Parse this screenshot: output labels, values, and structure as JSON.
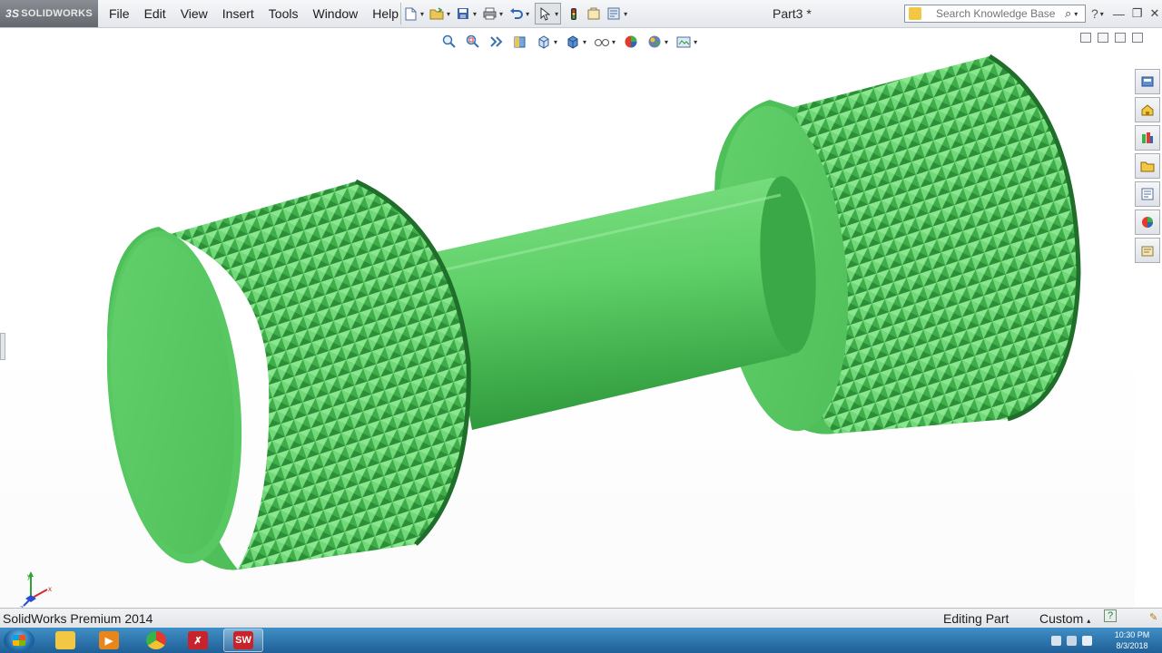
{
  "app": {
    "brand": "SOLIDWORKS",
    "document_title": "Part3 *"
  },
  "menu": {
    "items": [
      "File",
      "Edit",
      "View",
      "Insert",
      "Tools",
      "Window",
      "Help"
    ]
  },
  "quick_access": {
    "buttons": [
      "new-icon",
      "open-icon",
      "save-icon",
      "print-icon",
      "undo-icon",
      "select-icon",
      "rebuild-icon",
      "file-properties-icon",
      "options-icon"
    ]
  },
  "search": {
    "placeholder": "Search Knowledge Base"
  },
  "view_toolbar": {
    "buttons": [
      "zoom-to-fit-icon",
      "zoom-to-area-icon",
      "previous-view-icon",
      "section-view-icon",
      "view-orientation-icon",
      "display-style-icon",
      "hide-show-items-icon",
      "edit-appearance-icon",
      "apply-scene-icon",
      "view-settings-icon"
    ]
  },
  "task_pane": {
    "tabs": [
      "solidworks-resources-icon",
      "home-icon",
      "design-library-icon",
      "file-explorer-icon",
      "view-palette-icon",
      "appearances-icon",
      "custom-properties-icon"
    ]
  },
  "model": {
    "color": "#5fd068",
    "shade_dark": "#2f9a3c",
    "shade_light": "#8be690"
  },
  "triad": {
    "x_label": "x",
    "y_label": "y",
    "z_label": "z"
  },
  "status": {
    "product": "SolidWorks Premium 2014",
    "mode": "Editing Part",
    "units": "Custom"
  },
  "taskbar": {
    "apps": [
      "explorer-icon",
      "media-player-icon",
      "chrome-icon",
      "pdf-reader-icon",
      "solidworks-app-icon"
    ],
    "active_app": "SW",
    "time": "10:30 PM",
    "date": "8/3/2018"
  },
  "colors": {
    "accent": "#2a6fb0",
    "taskbar": "#2b73b0",
    "model_green": "#5fd068"
  }
}
